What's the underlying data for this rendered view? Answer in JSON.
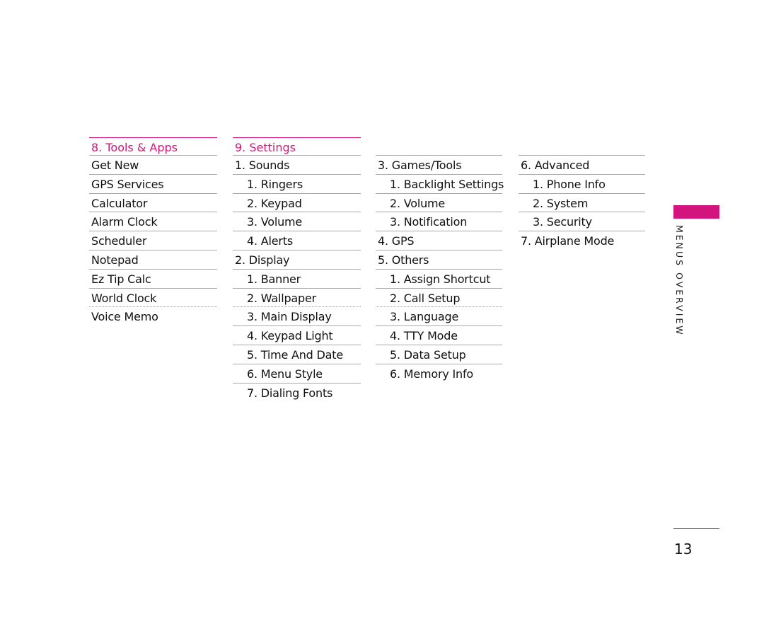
{
  "columns": {
    "tools": {
      "header": "8. Tools & Apps",
      "items": [
        "Get New",
        "GPS Services",
        "Calculator",
        "Alarm Clock",
        "Scheduler",
        "Notepad",
        "Ez Tip Calc",
        "World Clock",
        "Voice Memo"
      ]
    },
    "settings": {
      "header": "9. Settings",
      "items": [
        "1. Sounds",
        "1. Ringers",
        "2. Keypad",
        "3. Volume",
        "4. Alerts",
        "2. Display",
        "1. Banner",
        "2. Wallpaper",
        "3. Main Display",
        "4. Keypad Light",
        "5. Time And Date",
        "6. Menu Style",
        "7. Dialing Fonts"
      ]
    },
    "settings_cont": {
      "items": [
        "3. Games/Tools",
        "1. Backlight Settings",
        "2. Volume",
        "3. Notification",
        "4. GPS",
        "5. Others",
        "1. Assign Shortcut",
        "2. Call Setup",
        "3. Language",
        "4. TTY Mode",
        "5. Data Setup",
        "6. Memory Info"
      ]
    },
    "settings_cont2": {
      "items": [
        "6. Advanced",
        "1. Phone Info",
        "2. System",
        "3. Security",
        "7. Airplane Mode"
      ]
    }
  },
  "side_label": "MENUS OVERVIEW",
  "page_number": "13",
  "colors": {
    "accent": "#d4147e"
  }
}
